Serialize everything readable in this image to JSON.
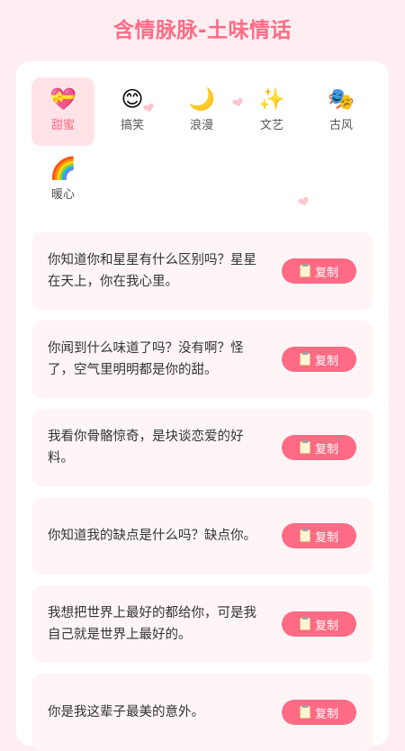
{
  "app": {
    "title": "含情脉脉-土味情话"
  },
  "categories": [
    {
      "emoji": "💝",
      "label": "甜蜜",
      "active": true
    },
    {
      "emoji": "😊",
      "label": "搞笑"
    },
    {
      "emoji": "🌙",
      "label": "浪漫"
    },
    {
      "emoji": "✨",
      "label": "文艺"
    },
    {
      "emoji": "🎭",
      "label": "古风"
    },
    {
      "emoji": "🌈",
      "label": "暖心"
    }
  ],
  "decor": {
    "heart": "❤"
  },
  "quotes": [
    {
      "text": "你知道你和星星有什么区别吗？星星在天上，你在我心里。"
    },
    {
      "text": "你闻到什么味道了吗？没有啊？怪了，空气里明明都是你的甜。"
    },
    {
      "text": "我看你骨骼惊奇，是块谈恋爱的好料。"
    },
    {
      "text": "你知道我的缺点是什么吗？缺点你。"
    },
    {
      "text": "我想把世界上最好的都给你，可是我自己就是世界上最好的。"
    },
    {
      "text": "你是我这辈子最美的意外。"
    }
  ],
  "actions": {
    "copy_label": "复制",
    "copy_icon": "clipboard-icon"
  },
  "colors": {
    "accent": "#ff6b85",
    "background": "#ffeef1",
    "card": "#ffffff",
    "quote_bg": "#fff5f6"
  }
}
